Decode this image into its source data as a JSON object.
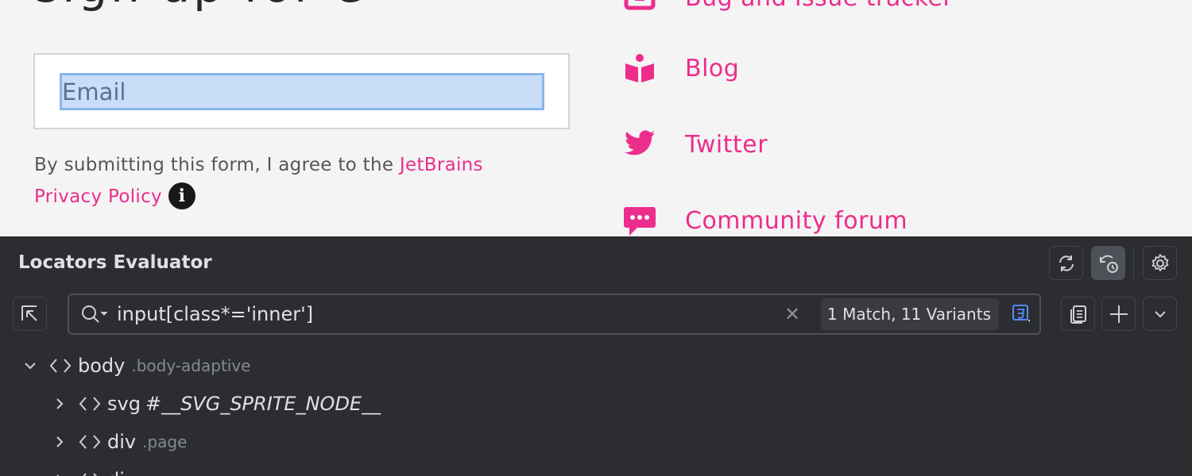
{
  "webpage": {
    "cut_heading": "sign up for e",
    "email_placeholder": "Email",
    "consent_text": "By submitting this form, I agree to the ",
    "consent_link": "JetBrains Privacy Policy",
    "links": [
      {
        "label": "Bug and issue tracker",
        "icon": "bug-tracker-icon"
      },
      {
        "label": "Blog",
        "icon": "blog-book-icon"
      },
      {
        "label": "Twitter",
        "icon": "twitter-bird-icon"
      },
      {
        "label": "Community forum",
        "icon": "chat-bubble-icon"
      }
    ],
    "accent_color": "#ec2d8c"
  },
  "panel": {
    "title": "Locators Evaluator",
    "search_value": "input[class*='inner']",
    "match_summary": "1 Match, 11 Variants",
    "toolbar_icons": [
      "sync-icon",
      "history-sync-icon",
      "settings-icon",
      "copy-icon",
      "add-icon",
      "chevron-down-icon",
      "pick-element-icon",
      "search-icon",
      "clear-icon",
      "css-selector-icon"
    ]
  },
  "tree": [
    {
      "tag": "body",
      "cls": ".body-adaptive",
      "expanded": true
    },
    {
      "tag": "svg",
      "id": "#__SVG_SPRITE_NODE__",
      "expanded": false
    },
    {
      "tag": "div",
      "cls": ".page",
      "expanded": false
    },
    {
      "tag": "div",
      "cls": "",
      "expanded": false
    }
  ]
}
